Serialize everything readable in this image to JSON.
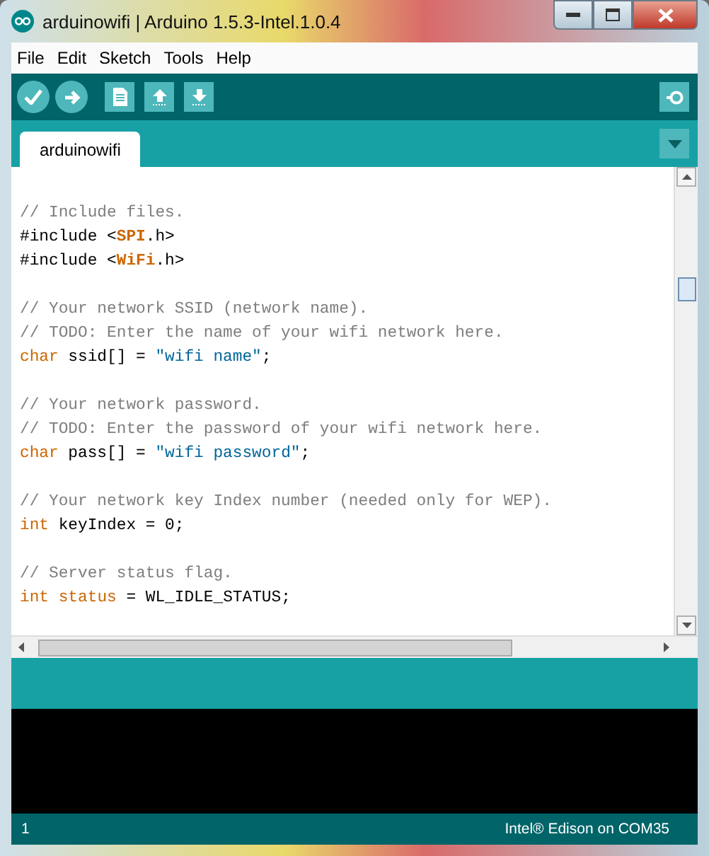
{
  "window": {
    "title": "arduinowifi | Arduino 1.5.3-Intel.1.0.4"
  },
  "menu": [
    "File",
    "Edit",
    "Sketch",
    "Tools",
    "Help"
  ],
  "tabs": [
    {
      "label": "arduinowifi",
      "selected": true
    }
  ],
  "code": [
    {
      "kind": "blank"
    },
    {
      "kind": "code",
      "segments": [
        {
          "text": "// Include files.",
          "kind": "comment"
        }
      ]
    },
    {
      "kind": "code",
      "segments": [
        {
          "text": "#include <",
          "kind": "plain"
        },
        {
          "text": "SPI",
          "kind": "library"
        },
        {
          "text": ".h>",
          "kind": "plain"
        }
      ]
    },
    {
      "kind": "code",
      "segments": [
        {
          "text": "#include <",
          "kind": "plain"
        },
        {
          "text": "WiFi",
          "kind": "library"
        },
        {
          "text": ".h>",
          "kind": "plain"
        }
      ]
    },
    {
      "kind": "blank"
    },
    {
      "kind": "code",
      "segments": [
        {
          "text": "// Your network SSID (network name).",
          "kind": "comment"
        }
      ]
    },
    {
      "kind": "code",
      "segments": [
        {
          "text": "// TODO: Enter the name of your wifi network here.",
          "kind": "comment"
        }
      ]
    },
    {
      "kind": "code",
      "segments": [
        {
          "text": "char",
          "kind": "keyword"
        },
        {
          "text": " ssid[] = ",
          "kind": "plain"
        },
        {
          "text": "\"wifi name\"",
          "kind": "string"
        },
        {
          "text": ";",
          "kind": "plain"
        }
      ]
    },
    {
      "kind": "blank"
    },
    {
      "kind": "code",
      "segments": [
        {
          "text": "// Your network password.",
          "kind": "comment"
        }
      ]
    },
    {
      "kind": "code",
      "segments": [
        {
          "text": "// TODO: Enter the password of your wifi network here.",
          "kind": "comment"
        }
      ]
    },
    {
      "kind": "code",
      "segments": [
        {
          "text": "char",
          "kind": "keyword"
        },
        {
          "text": " pass[] = ",
          "kind": "plain"
        },
        {
          "text": "\"wifi password\"",
          "kind": "string"
        },
        {
          "text": ";",
          "kind": "plain"
        }
      ]
    },
    {
      "kind": "blank"
    },
    {
      "kind": "code",
      "segments": [
        {
          "text": "// Your network key Index number (needed only for WEP).",
          "kind": "comment"
        }
      ]
    },
    {
      "kind": "code",
      "segments": [
        {
          "text": "int",
          "kind": "keyword"
        },
        {
          "text": " keyIndex = 0;",
          "kind": "plain"
        }
      ]
    },
    {
      "kind": "blank"
    },
    {
      "kind": "code",
      "segments": [
        {
          "text": "// Server status flag.",
          "kind": "comment"
        }
      ]
    },
    {
      "kind": "code",
      "segments": [
        {
          "text": "int",
          "kind": "keyword"
        },
        {
          "text": " status",
          "kind": "keyword"
        },
        {
          "text": " = WL_IDLE_STATUS;",
          "kind": "plain"
        }
      ]
    }
  ],
  "status": {
    "line": "1",
    "board": "Intel® Edison on COM35"
  }
}
